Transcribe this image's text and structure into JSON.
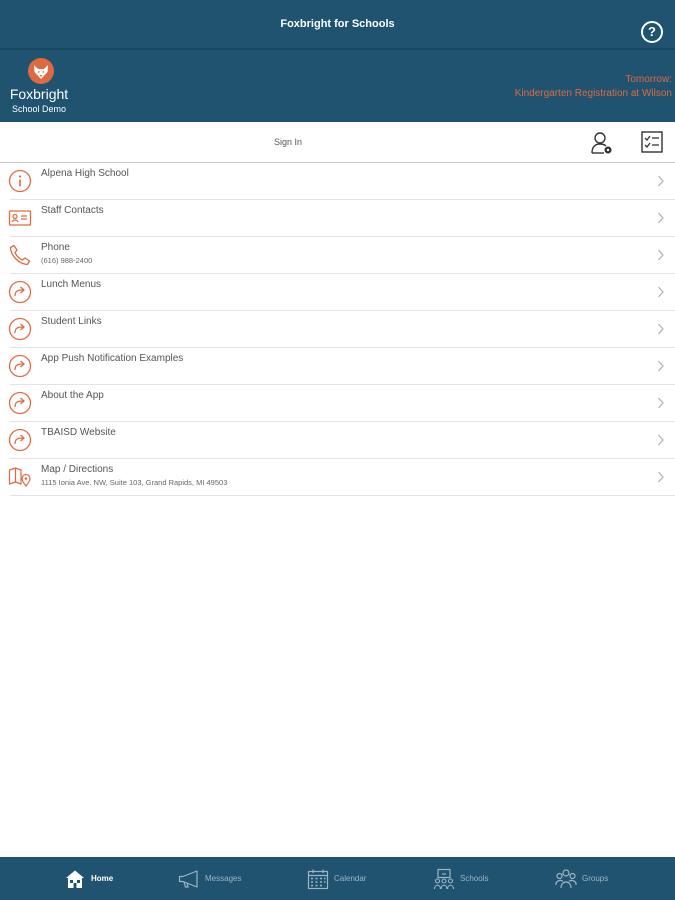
{
  "app": {
    "title": "Foxbright for Schools",
    "help_icon": "?"
  },
  "banner": {
    "logo_name": "Foxbright",
    "logo_sub": "School Demo",
    "announcement_line1": "Tomorrow:",
    "announcement_line2": "Kindergarten Registration at Wilson",
    "accent_color": "#e06a3f",
    "brand_color": "#1f5370"
  },
  "signin": {
    "label": "Sign In",
    "user_icon": "user-settings-icon",
    "checklist_icon": "checklist-icon"
  },
  "list": {
    "items": [
      {
        "label": "Alpena High School",
        "sub": "",
        "icon": "info-icon"
      },
      {
        "label": "Staff Contacts",
        "sub": "",
        "icon": "contact-card-icon"
      },
      {
        "label": "Phone",
        "sub": "(616) 988-2400",
        "icon": "phone-icon"
      },
      {
        "label": "Lunch Menus",
        "sub": "",
        "icon": "link-arrow-icon"
      },
      {
        "label": "Student Links",
        "sub": "",
        "icon": "link-arrow-icon"
      },
      {
        "label": "App Push Notification Examples",
        "sub": "",
        "icon": "link-arrow-icon"
      },
      {
        "label": "About the App",
        "sub": "",
        "icon": "link-arrow-icon"
      },
      {
        "label": "TBAISD Website",
        "sub": "",
        "icon": "link-arrow-icon"
      },
      {
        "label": "Map / Directions",
        "sub": "1115 Ionia Ave. NW, Suite 103, Grand Rapids, MI 49503",
        "icon": "map-pin-icon"
      }
    ]
  },
  "tabs": [
    {
      "label": "Home",
      "icon": "home-icon",
      "active": true
    },
    {
      "label": "Messages",
      "icon": "megaphone-icon",
      "active": false
    },
    {
      "label": "Calendar",
      "icon": "calendar-icon",
      "active": false
    },
    {
      "label": "Schools",
      "icon": "schools-icon",
      "active": false
    },
    {
      "label": "Groups",
      "icon": "groups-icon",
      "active": false
    }
  ]
}
